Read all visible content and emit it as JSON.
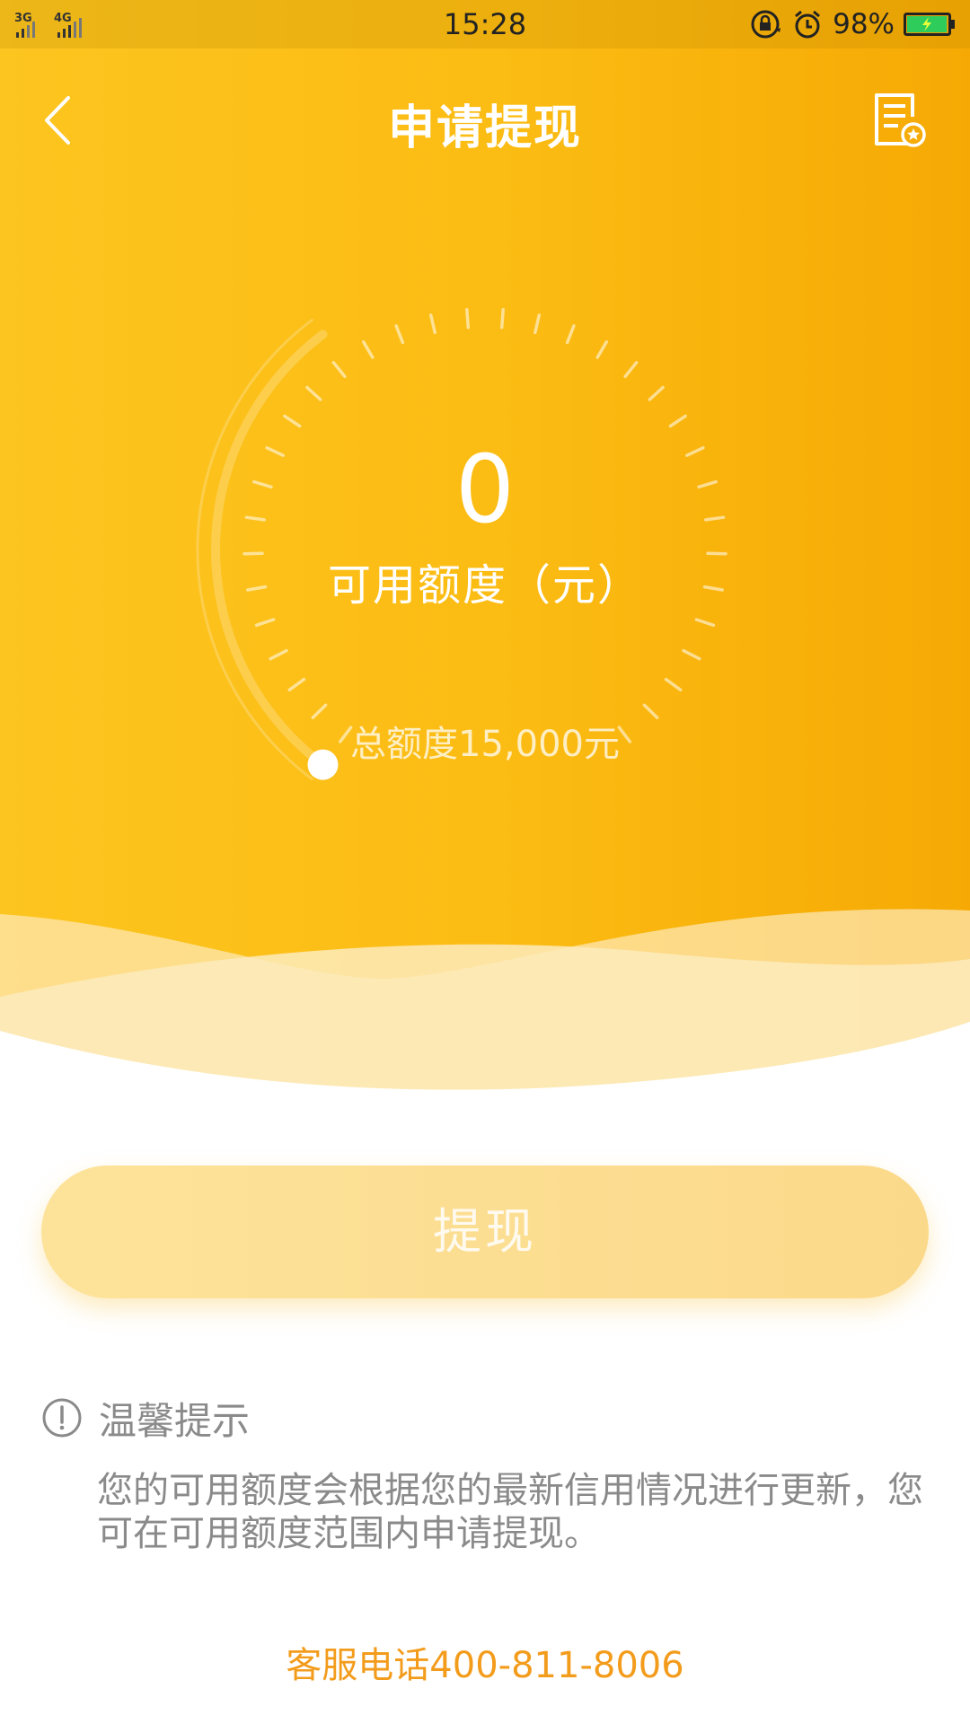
{
  "status_bar": {
    "network_left": "3G",
    "network_right": "4G",
    "time": "15:28",
    "battery_percent": "98%",
    "battery_level": 0.98,
    "icons": [
      "lock-rotation-icon",
      "alarm-icon",
      "battery-charging-icon"
    ]
  },
  "header": {
    "title": "申请提现",
    "back_icon": "chevron-left-icon",
    "records_icon": "document-star-icon"
  },
  "gauge": {
    "amount": "0",
    "label": "可用额度（元）",
    "total": "总额度15,000元",
    "fill_fraction": 0
  },
  "withdraw_button": {
    "label": "提现",
    "enabled": false
  },
  "tips": {
    "title": "温馨提示",
    "icon": "exclamation-circle-icon",
    "body": "您的可用额度会根据您的最新信用情况进行更新，您可在可用额度范围内申请提现。"
  },
  "hotline": "客服电话400-811-8006",
  "colors": {
    "primary": "#fbbb12",
    "primary_dark": "#f6a904",
    "button_disabled": "#fde39a",
    "hotline": "#f39c1c",
    "hint_text": "#8a8a8a"
  }
}
